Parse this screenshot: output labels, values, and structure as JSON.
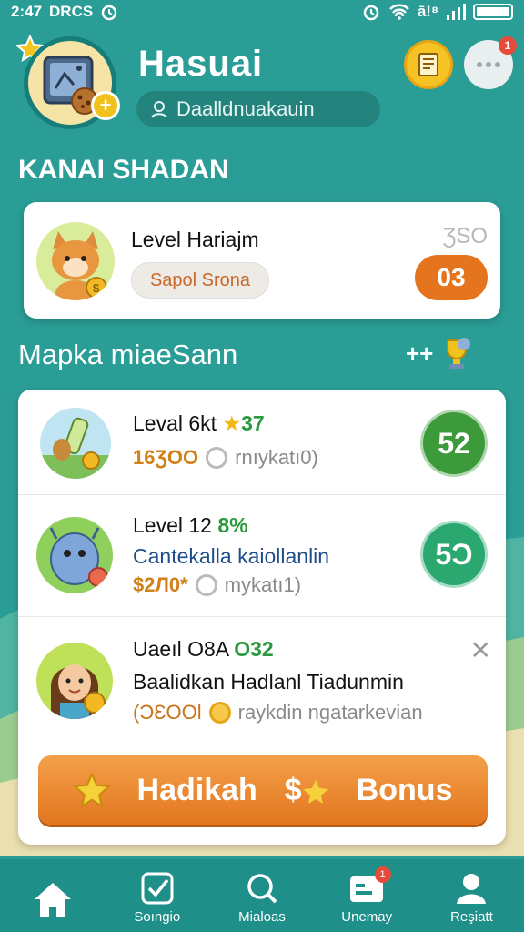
{
  "status_bar": {
    "time": "2:47",
    "carrier": "DRCS",
    "signal_text": "ā!⁸"
  },
  "header": {
    "title": "Hasuai",
    "username": "Daalldnuakauin"
  },
  "sections": {
    "top_title": "KANAI SHADAN",
    "list_title": "Mapka miaeSann"
  },
  "featured_card": {
    "label": "Level Hariajm",
    "pill": "Sapol Srona",
    "small_value": "ƷSO",
    "badge": "03",
    "badge_color": "#e5741e"
  },
  "list_header": {
    "plus": "++"
  },
  "list_rows": [
    {
      "title": "Leval 6kt",
      "accent": "37",
      "star": "★",
      "amount": "16ƷOO",
      "meta": "rnıykatı0)",
      "score": "52",
      "score_color": "#3c9a3a"
    },
    {
      "title": "Level 12",
      "accent": "8%",
      "desc": "Cantekalla kaiollanlin",
      "desc_color": "#1e4f8c",
      "amount": "$2Л0*",
      "meta": "mykatı1)",
      "score": "5Ɔ",
      "score_color": "#2aa870"
    },
    {
      "title": "Uaeıl O8A",
      "accent": "O32",
      "desc": "Baalidkan Hadlanl Tiadunmin",
      "desc_color": "#111111",
      "amount": "(ϽƐOOl",
      "meta": "raykdin ngatarkevian"
    }
  ],
  "bonus_button": {
    "left": "Hadikah",
    "mid": "$",
    "right": "Bonus"
  },
  "bottom_nav": [
    {
      "label": ""
    },
    {
      "label": "Soıngio"
    },
    {
      "label": "Mialoas"
    },
    {
      "label": "Unemay",
      "badge": "1"
    },
    {
      "label": "Reşiatt"
    }
  ],
  "notification_count": "1"
}
